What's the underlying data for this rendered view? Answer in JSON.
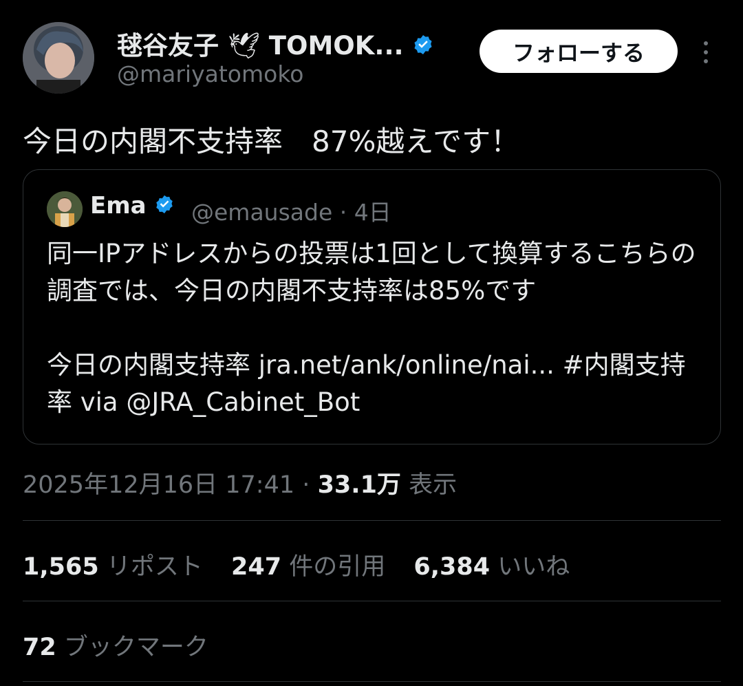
{
  "author": {
    "name": "毬谷友子",
    "name_suffix": "TOMOK...",
    "handle": "@mariyatomoko",
    "emoji": "🕊"
  },
  "follow_button": "フォローする",
  "tweet_text": "今日の内閣不支持率　87%越えです！",
  "quote": {
    "name": "Ema",
    "handle": "@emausade",
    "separator": "·",
    "age": "4日",
    "line1": "同一IPアドレスからの投票は1回として換算するこちらの調査では、今日の内閣不支持率は85%です",
    "line2": "今日の内閣支持率 jra.net/ank/online/nai... #内閣支持率 via @JRA_Cabinet_Bot"
  },
  "meta": {
    "timestamp": "2025年12月16日 17:41",
    "separator": "·",
    "views_count": "33.1万",
    "views_label": "表示"
  },
  "stats": {
    "reposts_count": "1,565",
    "reposts_label": "リポスト",
    "quotes_count": "247",
    "quotes_label": "件の引用",
    "likes_count": "6,384",
    "likes_label": "いいね",
    "bookmarks_count": "72",
    "bookmarks_label": "ブックマーク"
  },
  "colors": {
    "background": "#000000",
    "text": "#e7e9ea",
    "secondary": "#71767b",
    "verified": "#1d9bf0",
    "divider": "#2f3336"
  }
}
